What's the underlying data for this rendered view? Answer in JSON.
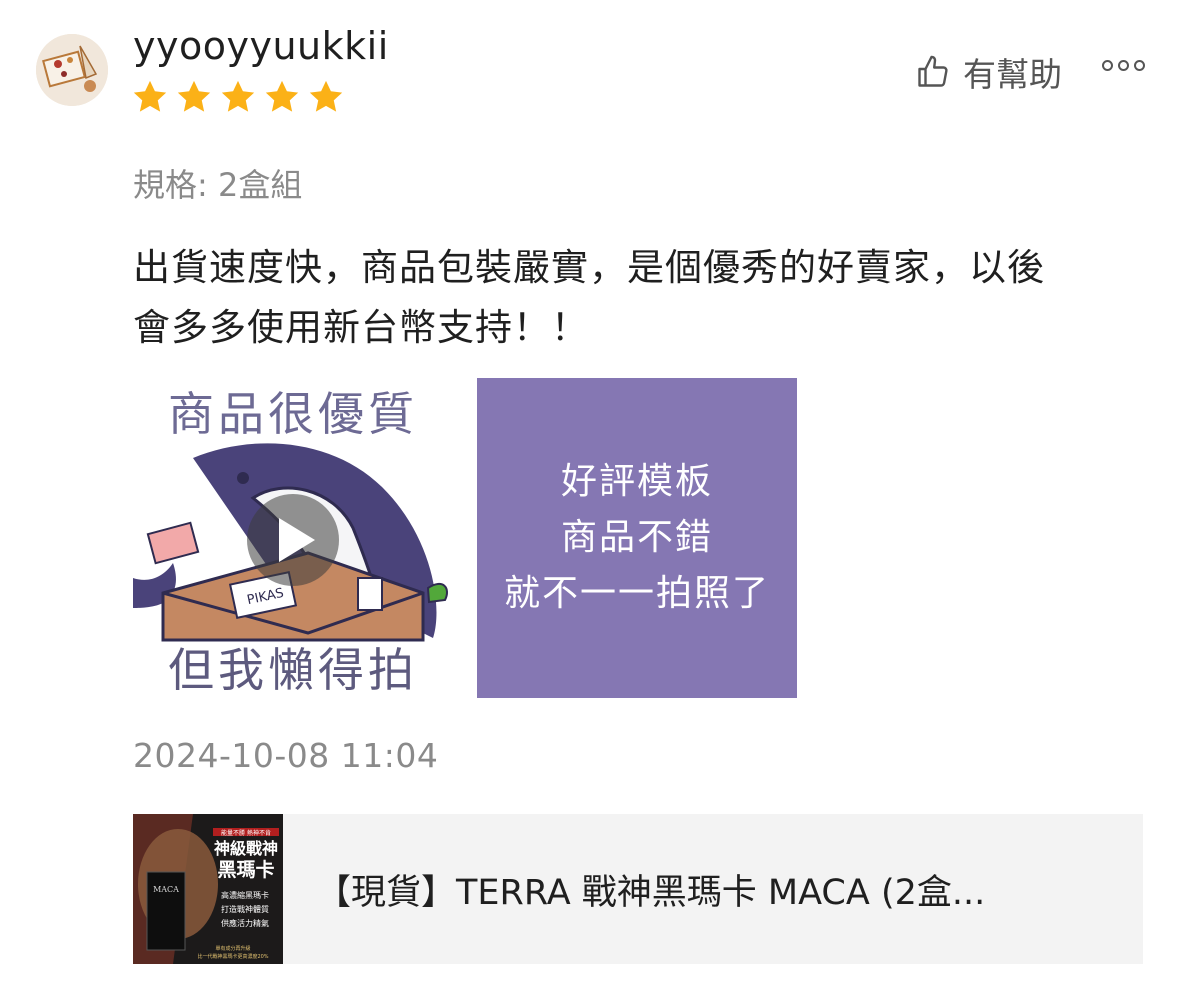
{
  "review": {
    "username": "yyooyyuukkii",
    "rating": 5,
    "helpful_label": "有幫助",
    "variation": "規格: 2盒組",
    "text_line1": "出貨速度快，商品包裝嚴實，是個優秀的好賣家，以後",
    "text_line2": "會多多使用新台幣支持！！",
    "timestamp": "2024-10-08 11:04"
  },
  "media": {
    "image1_caption_top": "商品很優質",
    "image1_caption_bottom": "但我懶得拍",
    "image1_box_label": "PIKAS",
    "image2_lines": [
      "好評模板",
      "商品不錯",
      "就不一一拍照了"
    ]
  },
  "product": {
    "name": "【現貨】TERRA 戰神黑瑪卡 MACA (2盒...",
    "thumb_tagline": "能量不勝 熱神不肯",
    "thumb_title1": "神級戰神",
    "thumb_title2": "黑瑪卡",
    "thumb_brand": "MACA",
    "thumb_points": [
      "高濃縮黑瑪卡",
      "打造戰神體質",
      "供應活力精氣"
    ],
    "thumb_footer1": "單有成分再升級",
    "thumb_footer2": "比一代戰神黑瑪卡更高濃度20%"
  },
  "colors": {
    "star": "#fbb117",
    "media_purple": "#8577b3",
    "meta_gray": "#8a8a8a",
    "product_bg": "#f3f3f3"
  },
  "icons": {
    "helpful": "thumbs-up-icon",
    "more": "more-options-icon",
    "play": "play-icon"
  }
}
